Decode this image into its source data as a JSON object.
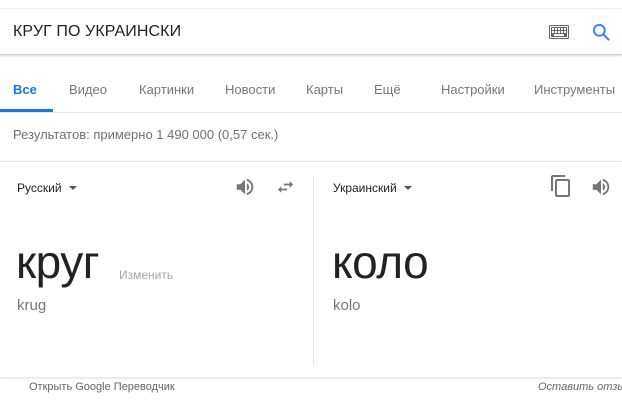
{
  "search": {
    "query": "КРУГ ПО УКРАИНСКИ"
  },
  "tabs": [
    {
      "label": "Все"
    },
    {
      "label": "Видео"
    },
    {
      "label": "Картинки"
    },
    {
      "label": "Новости"
    },
    {
      "label": "Карты"
    },
    {
      "label": "Ещё"
    },
    {
      "label": "Настройки"
    },
    {
      "label": "Инструменты"
    }
  ],
  "results_stats": "Результатов: примерно 1 490 000 (0,57 сек.)",
  "translator": {
    "source": {
      "language": "Русский",
      "word": "круг",
      "transliteration": "krug",
      "edit_label": "Изменить"
    },
    "target": {
      "language": "Украинский",
      "word": "коло",
      "transliteration": "kolo"
    }
  },
  "footer": {
    "open_translator": "Открыть Google Переводчик",
    "feedback": "Оставить отзыв"
  },
  "colors": {
    "accent": "#1a73e8",
    "icon_gray": "#757575"
  }
}
